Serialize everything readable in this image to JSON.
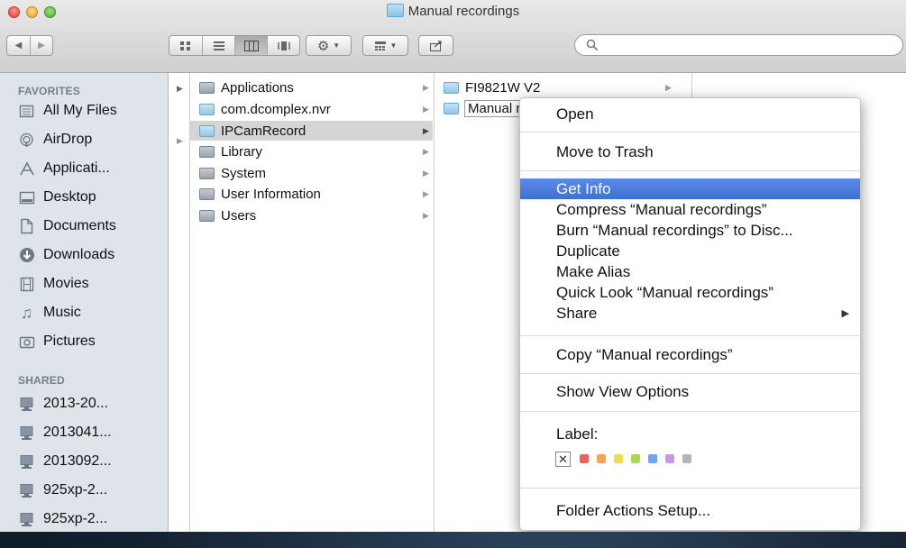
{
  "window": {
    "title": "Manual recordings"
  },
  "toolbar": {
    "back_icon": "back-arrow-icon",
    "forward_icon": "forward-arrow-icon",
    "view_icons": [
      "icon-view-icon",
      "list-view-icon",
      "column-view-icon",
      "coverflow-view-icon"
    ],
    "action_icon": "gear-icon",
    "arrange_icon": "arrange-icon",
    "share_icon": "share-icon",
    "search": {
      "placeholder": "",
      "value": ""
    }
  },
  "sidebar": {
    "favorites_header": "FAVORITES",
    "favorites": [
      {
        "label": "All My Files",
        "icon": "all-files-icon"
      },
      {
        "label": "AirDrop",
        "icon": "airdrop-icon"
      },
      {
        "label": "Applicati...",
        "icon": "applications-icon"
      },
      {
        "label": "Desktop",
        "icon": "desktop-icon"
      },
      {
        "label": "Documents",
        "icon": "documents-icon"
      },
      {
        "label": "Downloads",
        "icon": "downloads-icon"
      },
      {
        "label": "Movies",
        "icon": "movies-icon"
      },
      {
        "label": "Music",
        "icon": "music-icon"
      },
      {
        "label": "Pictures",
        "icon": "pictures-icon"
      }
    ],
    "shared_header": "SHARED",
    "shared": [
      {
        "label": "2013-20...",
        "icon": "computer-icon"
      },
      {
        "label": "2013041...",
        "icon": "computer-icon"
      },
      {
        "label": "2013092...",
        "icon": "computer-icon"
      },
      {
        "label": "925xp-2...",
        "icon": "computer-icon"
      },
      {
        "label": "925xp-2...",
        "icon": "computer-icon"
      }
    ]
  },
  "columns": {
    "col1": [
      {
        "label": "Applications",
        "icon": "applications-folder-icon",
        "selected": false
      },
      {
        "label": "com.dcomplex.nvr",
        "icon": "folder-icon",
        "selected": false
      },
      {
        "label": "IPCamRecord",
        "icon": "folder-icon",
        "selected": true
      },
      {
        "label": "Library",
        "icon": "library-folder-icon",
        "selected": false
      },
      {
        "label": "System",
        "icon": "system-folder-icon",
        "selected": false
      },
      {
        "label": "User Information",
        "icon": "user-info-icon",
        "selected": false
      },
      {
        "label": "Users",
        "icon": "users-folder-icon",
        "selected": false
      }
    ],
    "col2": [
      {
        "label": "FI9821W V2",
        "icon": "folder-icon"
      },
      {
        "label": "Manual re",
        "icon": "folder-icon"
      }
    ]
  },
  "context_menu": {
    "open": "Open",
    "move_to_trash": "Move to Trash",
    "get_info": "Get Info",
    "compress": "Compress “Manual recordings”",
    "burn": "Burn “Manual recordings” to Disc...",
    "duplicate": "Duplicate",
    "make_alias": "Make Alias",
    "quick_look": "Quick Look “Manual recordings”",
    "share": "Share",
    "copy": "Copy “Manual recordings”",
    "show_view_options": "Show View Options",
    "label": "Label:",
    "label_none": "✕",
    "label_colors": [
      "#f0605a",
      "#f4a64e",
      "#eedc52",
      "#a9d858",
      "#6fa3ee",
      "#c49ae6",
      "#b4b4b4"
    ],
    "folder_actions": "Folder Actions Setup..."
  }
}
